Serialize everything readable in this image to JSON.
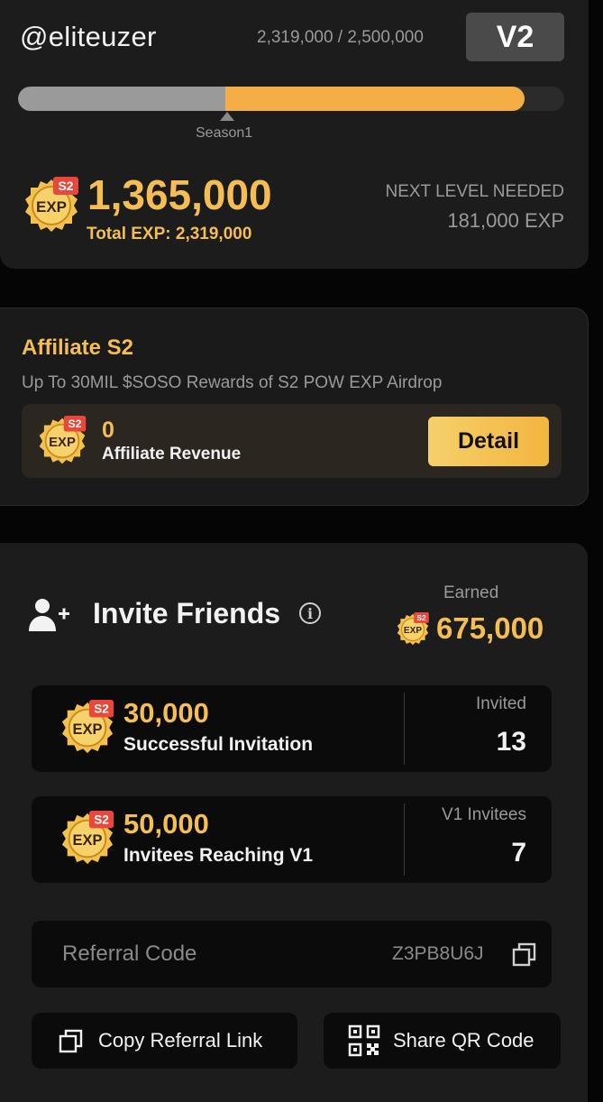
{
  "header": {
    "username": "@eliteuzer",
    "exp_progress": "2,319,000 / 2,500,000",
    "level": "V2",
    "progress_fraction": 0.928,
    "season_fraction": 0.38,
    "season_label": "Season1"
  },
  "season_exp": {
    "badge_season": "S2",
    "badge_text": "EXP",
    "value": "1,365,000",
    "total": "Total EXP: 2,319,000",
    "next_level_label": "NEXT LEVEL NEEDED",
    "next_level_value": "181,000 EXP"
  },
  "affiliate": {
    "title": "Affiliate S2",
    "subtitle": "Up To 30MIL $SOSO Rewards of S2 POW EXP Airdrop",
    "value": "0",
    "label": "Affiliate Revenue",
    "detail_label": "Detail"
  },
  "invite": {
    "title": "Invite Friends",
    "info_icon": "i",
    "earned_label": "Earned",
    "earned_value": "675,000",
    "rewards": [
      {
        "value": "30,000",
        "label": "Successful Invitation",
        "stat_label": "Invited",
        "stat_value": "13"
      },
      {
        "value": "50,000",
        "label": "Invitees Reaching V1",
        "stat_label": "V1 Invitees",
        "stat_value": "7"
      }
    ],
    "referral_label": "Referral Code",
    "referral_code": "Z3PB8U6J",
    "copy_link_label": "Copy Referral Link",
    "share_qr_label": "Share QR Code"
  },
  "colors": {
    "accent": "#f5be55",
    "progress": "#f5ae45",
    "card": "#1c1c1c",
    "badge_red": "#e8473a"
  },
  "icons": [
    "exp-badge-icon",
    "add-user-icon",
    "info-icon",
    "copy-icon",
    "qr-code-icon"
  ]
}
